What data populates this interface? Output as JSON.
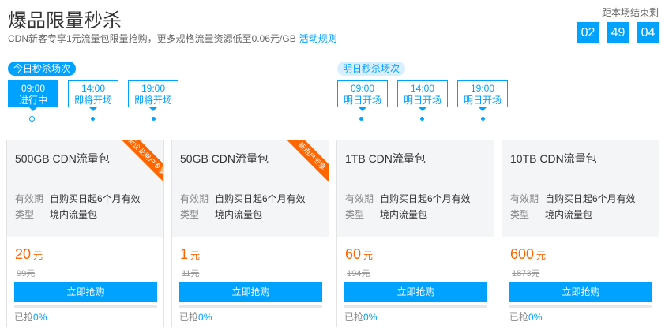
{
  "header": {
    "title": "爆品限量秒杀",
    "subtitle": "CDN新客专享1元流量包限量抢购，更多规格流量资源低至0.06元/GB",
    "rules_link": "活动规则"
  },
  "countdown": {
    "label": "距本场结束剩",
    "hours": "02",
    "minutes": "49",
    "seconds": "04"
  },
  "today": {
    "label": "今日秒杀场次",
    "slots": [
      {
        "time": "09:00",
        "status": "进行中"
      },
      {
        "time": "14:00",
        "status": "即将开场"
      },
      {
        "time": "19:00",
        "status": "即将开场"
      }
    ]
  },
  "tomorrow": {
    "label": "明日秒杀场次",
    "slots": [
      {
        "time": "09:00",
        "status": "明日开场"
      },
      {
        "time": "14:00",
        "status": "明日开场"
      },
      {
        "time": "19:00",
        "status": "明日开场"
      }
    ]
  },
  "products": [
    {
      "name": "500GB CDN流量包",
      "badge": "新企业用户专享",
      "validity_label": "有效期",
      "validity": "自购买日起6个月有效",
      "type_label": "类型",
      "type": "境内流量包",
      "price": "20",
      "unit": "元",
      "original": "99元",
      "button": "立即抢购",
      "sold_label": "已抢",
      "sold": "0%"
    },
    {
      "name": "50GB CDN流量包",
      "badge": "新用户专享",
      "validity_label": "有效期",
      "validity": "自购买日起6个月有效",
      "type_label": "类型",
      "type": "境内流量包",
      "price": "1",
      "unit": "元",
      "original": "11元",
      "button": "立即抢购",
      "sold_label": "已抢",
      "sold": "0%"
    },
    {
      "name": "1TB CDN流量包",
      "badge": "",
      "validity_label": "有效期",
      "validity": "自购买日起6个月有效",
      "type_label": "类型",
      "type": "境内流量包",
      "price": "60",
      "unit": "元",
      "original": "194元",
      "button": "立即抢购",
      "sold_label": "已抢",
      "sold": "0%"
    },
    {
      "name": "10TB CDN流量包",
      "badge": "",
      "validity_label": "有效期",
      "validity": "自购买日起6个月有效",
      "type_label": "类型",
      "type": "境内流量包",
      "price": "600",
      "unit": "元",
      "original": "1873元",
      "button": "立即抢购",
      "sold_label": "已抢",
      "sold": "0%"
    }
  ],
  "colors": {
    "accent": "#00a2ff",
    "price": "#ff6600",
    "ribbon": "#ff6600"
  }
}
